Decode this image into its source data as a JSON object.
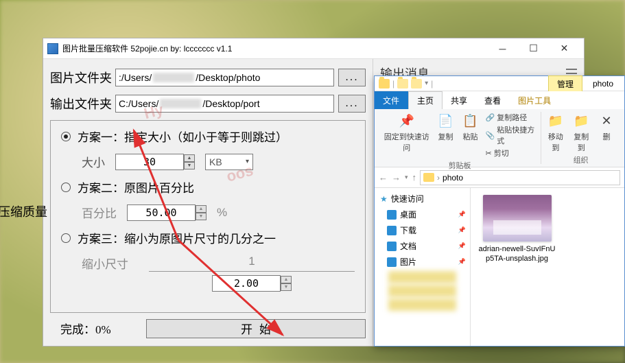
{
  "app": {
    "title": "图片批量压缩软件  52pojie.cn   by: lccccccc     v1.1",
    "source_folder_label": "图片文件夹",
    "output_folder_label": "输出文件夹",
    "source_path_prefix": ":/Users/",
    "source_path_suffix": "/Desktop/photo",
    "output_path_prefix": "C:/Users/",
    "output_path_suffix": "/Desktop/port",
    "browse_label": "...",
    "quality_label": "压缩质量",
    "output_title": "输出消息",
    "plan1": "方案一：指定大小（如小于等于则跳过）",
    "plan1_sub": "大小",
    "plan1_value": "30",
    "plan1_unit": "KB",
    "plan2": "方案二：原图片百分比",
    "plan2_sub": "百分比",
    "plan2_value": "50.00",
    "plan2_unit": "%",
    "plan3": "方案三：缩小为原图片尺寸的几分之一",
    "plan3_sub": "缩小尺寸",
    "plan3_num": "1",
    "plan3_den": "2.00",
    "progress": "完成：0%",
    "start": "开始"
  },
  "explorer": {
    "manage": "管理",
    "folder_name": "photo",
    "tab_file": "文件",
    "tab_home": "主页",
    "tab_share": "共享",
    "tab_view": "查看",
    "tab_picture_tools": "图片工具",
    "ribbon": {
      "pin_quick": "固定到快速访问",
      "copy": "复制",
      "paste": "粘贴",
      "copy_path": "复制路径",
      "paste_shortcut": "粘贴快捷方式",
      "cut": "剪切",
      "clipboard_group": "剪贴板",
      "move_to": "移动到",
      "copy_to": "复制到",
      "delete": "删",
      "organize_group": "组织"
    },
    "address": "photo",
    "sidebar": {
      "quick_access": "快速访问",
      "desktop": "桌面",
      "downloads": "下载",
      "documents": "文档",
      "pictures": "图片"
    },
    "thumbnail_filename": "adrian-newell-SuvIFnUp5TA-unsplash.jpg"
  }
}
